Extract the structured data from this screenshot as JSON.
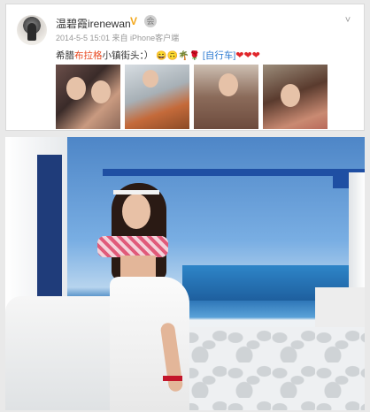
{
  "post": {
    "username": "温碧霞irenewan",
    "verified_badge": "V",
    "member_badge": "会",
    "meta": "2014-5-5 15:01 来自 iPhone客户端",
    "text_prefix": "希腊",
    "text_highlight": "布拉格",
    "text_middle": "小镇街头：）",
    "emojis": "😄🙃🌴🌹",
    "link_text": "[自行车]",
    "hearts": "❤❤❤",
    "menu_chevron": "˅"
  },
  "photos": {
    "thumbnails": [
      "thumb-1",
      "thumb-2",
      "thumb-3",
      "thumb-4"
    ]
  },
  "colors": {
    "accent_orange": "#e84a22",
    "link_blue": "#2b7ad1",
    "badge_gold": "#f3a81c"
  }
}
